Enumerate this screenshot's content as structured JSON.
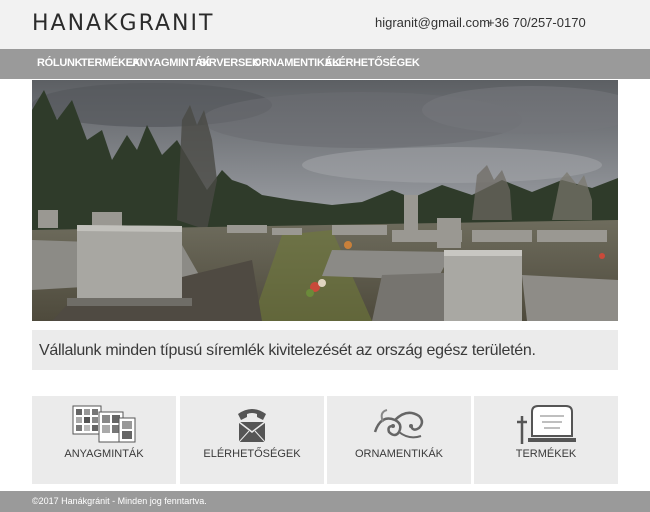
{
  "header": {
    "logo_text": "HANAKGRANIT",
    "email": "higranit@gmail.com",
    "phone": "+36 70/257-0170"
  },
  "nav": {
    "items": [
      {
        "label": "RÓLUNK"
      },
      {
        "label": "TERMÉKEK"
      },
      {
        "label": "ANYAGMINTÁK"
      },
      {
        "label": "SÍRVERSEK"
      },
      {
        "label": "ORNAMENTIKÁK"
      },
      {
        "label": "ELÉRHETŐSÉGEK"
      }
    ]
  },
  "hero": {
    "image": "cemetery-photo"
  },
  "tagline": "Vállalunk minden típusú síremlék kivitelezését az ország egész területén.",
  "tiles": [
    {
      "label": "ANYAGMINTÁK",
      "icon": "material-samples-icon"
    },
    {
      "label": "ELÉRHETŐSÉGEK",
      "icon": "telephone-mail-icon"
    },
    {
      "label": "ORNAMENTIKÁK",
      "icon": "ornament-icon"
    },
    {
      "label": "TERMÉKEK",
      "icon": "gravestone-icon"
    }
  ],
  "footer": {
    "copyright": "©2017 Hanákgránit - Minden jog fenntartva."
  }
}
